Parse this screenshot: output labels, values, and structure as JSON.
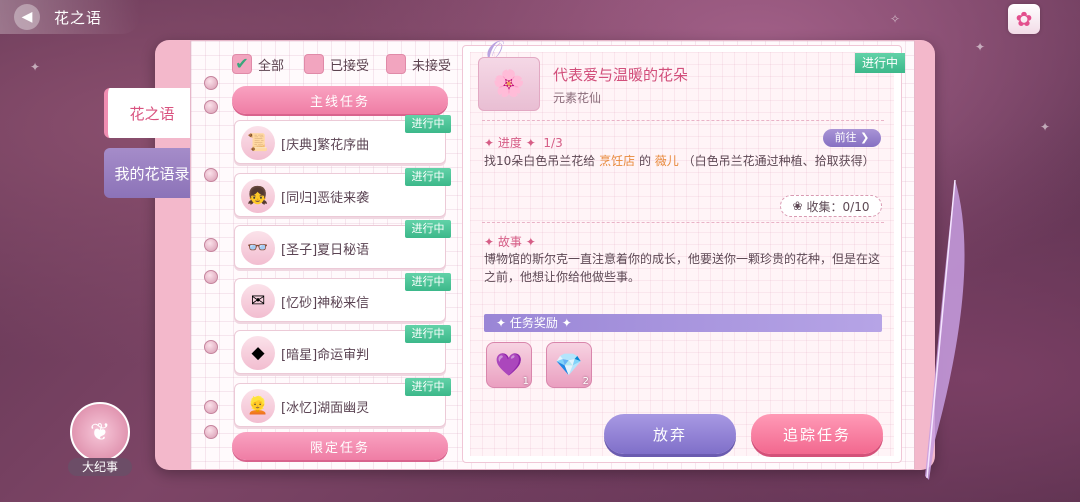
{
  "header": {
    "title": "花之语",
    "back_icon": "arrow-left-icon",
    "close_icon": "close-icon"
  },
  "sidebar_tabs": [
    {
      "label": "花之语",
      "active": true
    },
    {
      "label": "我的花语录",
      "active": false
    }
  ],
  "filters": [
    {
      "label": "全部",
      "checked": true
    },
    {
      "label": "已接受",
      "checked": false
    },
    {
      "label": "未接受",
      "checked": false
    }
  ],
  "main_category": "主线任务",
  "quests": [
    {
      "label": "[庆典]繁花序曲",
      "badge": "进行中",
      "icon": "scroll-icon"
    },
    {
      "label": "[同归]恶徒来袭",
      "badge": "进行中",
      "icon": "girl-portrait-icon"
    },
    {
      "label": "[圣子]夏日秘语",
      "badge": "进行中",
      "icon": "glasses-icon"
    },
    {
      "label": "[忆砂]神秘来信",
      "badge": "进行中",
      "icon": "envelope-icon"
    },
    {
      "label": "[暗星]命运审判",
      "badge": "进行中",
      "icon": "broken-tablet-icon"
    },
    {
      "label": "[冰忆]湖面幽灵",
      "badge": "进行中",
      "icon": "blonde-girl-icon"
    }
  ],
  "limited_category": "限定任务",
  "detail": {
    "title": "代表爱与温暖的花朵",
    "subtitle": "元素花仙",
    "status": "进行中",
    "progress_label": "进度",
    "progress_value": "1/3",
    "goto_label": "前往",
    "desc_prefix": "找10朵白色吊兰花给",
    "desc_place": "烹饪店",
    "desc_de": "的",
    "desc_person": "薇儿",
    "desc_suffix": "（白色吊兰花通过种植、拾取获得）",
    "collect_label": "收集：0/10",
    "story_label": "故事",
    "story_text": "博物馆的斯尔克一直注意着你的成长，他要送你一颗珍贵的花种，但是在这之前，他想让你给他做些事。",
    "reward_label": "任务奖励",
    "rewards": [
      {
        "icon": "sparkle-potion-icon",
        "count": "1"
      },
      {
        "icon": "gem-icon",
        "count": "2"
      }
    ],
    "abandon_label": "放弃",
    "track_label": "追踪任务"
  },
  "chronicle_label": "大纪事",
  "colors": {
    "accent": "#ef7da5",
    "badge": "#3cb88a",
    "purple": "#8670c2"
  }
}
